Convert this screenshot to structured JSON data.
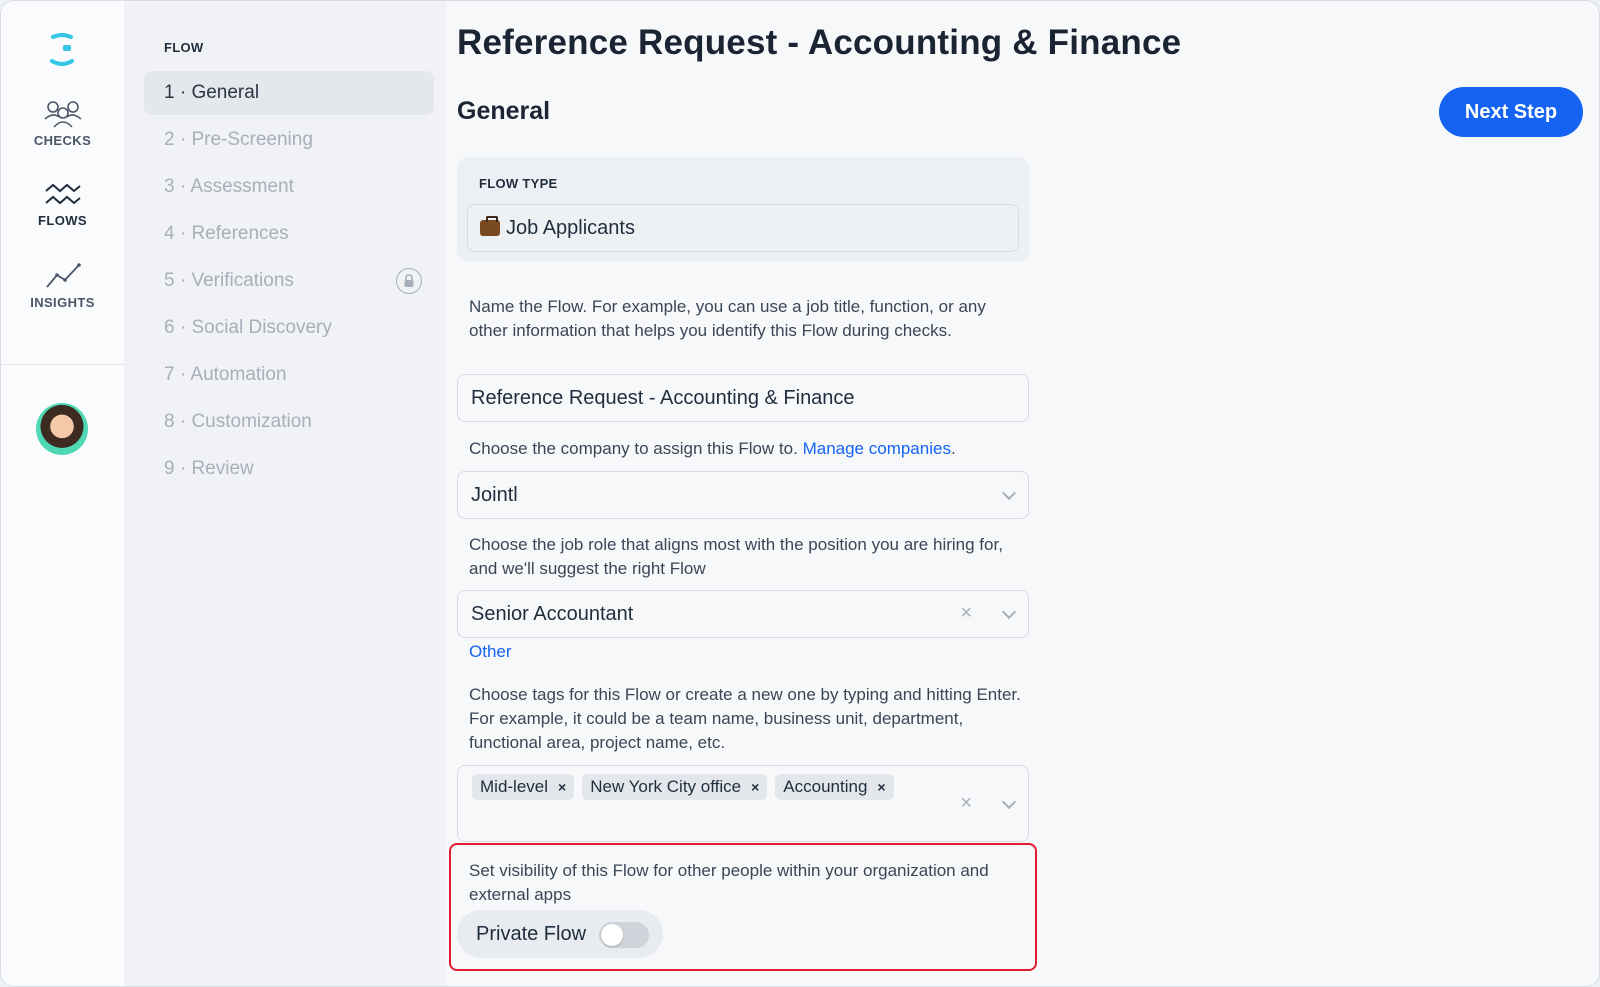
{
  "rail": {
    "items": [
      {
        "label": "CHECKS",
        "icon": "people-icon"
      },
      {
        "label": "FLOWS",
        "icon": "waves-icon"
      },
      {
        "label": "INSIGHTS",
        "icon": "trend-icon"
      }
    ]
  },
  "steps": {
    "title": "FLOW",
    "items": [
      {
        "label": "1 · General"
      },
      {
        "label": "2 · Pre-Screening"
      },
      {
        "label": "3 · Assessment"
      },
      {
        "label": "4 · References"
      },
      {
        "label": "5 · Verifications"
      },
      {
        "label": "6 · Social Discovery"
      },
      {
        "label": "7 · Automation"
      },
      {
        "label": "8 · Customization"
      },
      {
        "label": "9 · Review"
      }
    ]
  },
  "page": {
    "title": "Reference Request - Accounting & Finance",
    "section": "General",
    "next_label": "Next Step"
  },
  "flow_type": {
    "label": "FLOW TYPE",
    "value": "Job Applicants"
  },
  "name": {
    "help": "Name the Flow. For example, you can use a job title, function, or any other information that helps you identify this Flow during checks.",
    "value": "Reference Request - Accounting & Finance"
  },
  "company": {
    "help": "Choose the company to assign this Flow to.",
    "link": "Manage companies",
    "suffix": ".",
    "value": "Jointl"
  },
  "role": {
    "help": "Choose the job role that aligns most with the position you are hiring for, and we'll suggest the right Flow",
    "value": "Senior Accountant",
    "other": "Other"
  },
  "tags": {
    "help": "Choose tags for this Flow or create a new one by typing and hitting Enter. For example, it could be a team name, business unit, department, functional area, project name, etc.",
    "items": [
      "Mid-level",
      "New York City office",
      "Accounting"
    ],
    "remove": "×"
  },
  "visibility": {
    "help": "Set visibility of this Flow for other people within your organization and external apps",
    "toggle_label": "Private Flow",
    "toggle_on": false
  },
  "colors": {
    "accent": "#1463f3",
    "highlight": "#e01d2d"
  }
}
